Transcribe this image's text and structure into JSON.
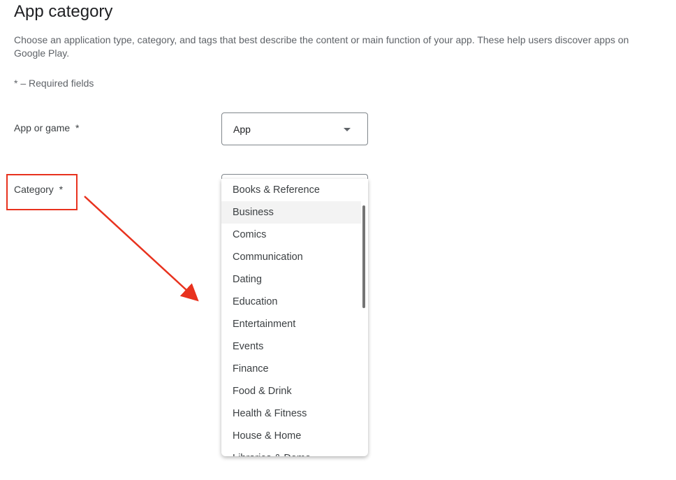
{
  "page": {
    "title": "App category",
    "description": "Choose an application type, category, and tags that best describe the content or main function of your app. These help users discover apps on Google Play.",
    "required_note": "* – Required fields"
  },
  "fields": {
    "app_or_game": {
      "label": "App or game  *",
      "value": "App"
    },
    "category": {
      "label": "Category  *",
      "options": [
        "Books & Reference",
        "Business",
        "Comics",
        "Communication",
        "Dating",
        "Education",
        "Entertainment",
        "Events",
        "Finance",
        "Food & Drink",
        "Health & Fitness",
        "House & Home",
        "Libraries & Demo"
      ],
      "highlighted": "Business"
    }
  },
  "annotation": {
    "color": "#e8321e"
  }
}
